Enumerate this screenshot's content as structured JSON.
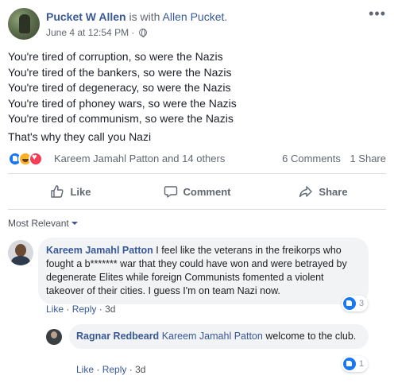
{
  "post": {
    "author": "Pucket W Allen",
    "is_with": "is with",
    "with_name": "Allen Pucket.",
    "timestamp": "June 4 at 12:54 PM",
    "separator": "·",
    "more_icon": "ellipsis-icon",
    "lines": [
      "You're tired of corruption, so were the Nazis",
      "You're tired of the bankers, so were the Nazis",
      "You're tired of degeneracy, so were the Nazis",
      "You're tired of phoney wars, so were the Nazis",
      "You're tired of communism, so were the Nazis"
    ],
    "closing": "That's why they call you Nazi"
  },
  "reactions": {
    "icons": [
      "like-icon",
      "haha-icon",
      "love-icon"
    ],
    "names": "Kareem Jamahl Patton and 14 others",
    "comments_count": "6 Comments",
    "shares_count": "1 Share"
  },
  "actions": {
    "like": "Like",
    "comment": "Comment",
    "share": "Share"
  },
  "sort": {
    "label": "Most Relevant"
  },
  "comments": [
    {
      "author": "Kareem Jamahl Patton",
      "text": "I feel like the veterans in the freikorps who fought a b******* war that they could have won and were betrayed by degenerate Elites while foreign Communists fomented a violent takeover of their cities. I guess I'm on team Nazi now.",
      "like": "Like",
      "reply": "Reply",
      "dot": "·",
      "age": "3d",
      "reaction_count": "3"
    },
    {
      "author": "Ragnar Redbeard",
      "mention": "Kareem Jamahl Patton",
      "text": "welcome to the club.",
      "like": "Like",
      "reply": "Reply",
      "dot": "·",
      "age": "3d",
      "reaction_count": "1"
    }
  ],
  "colors": {
    "link": "#385898",
    "meta": "#616770",
    "bubble": "#f2f3f5",
    "like_blue": "#1877f2"
  }
}
